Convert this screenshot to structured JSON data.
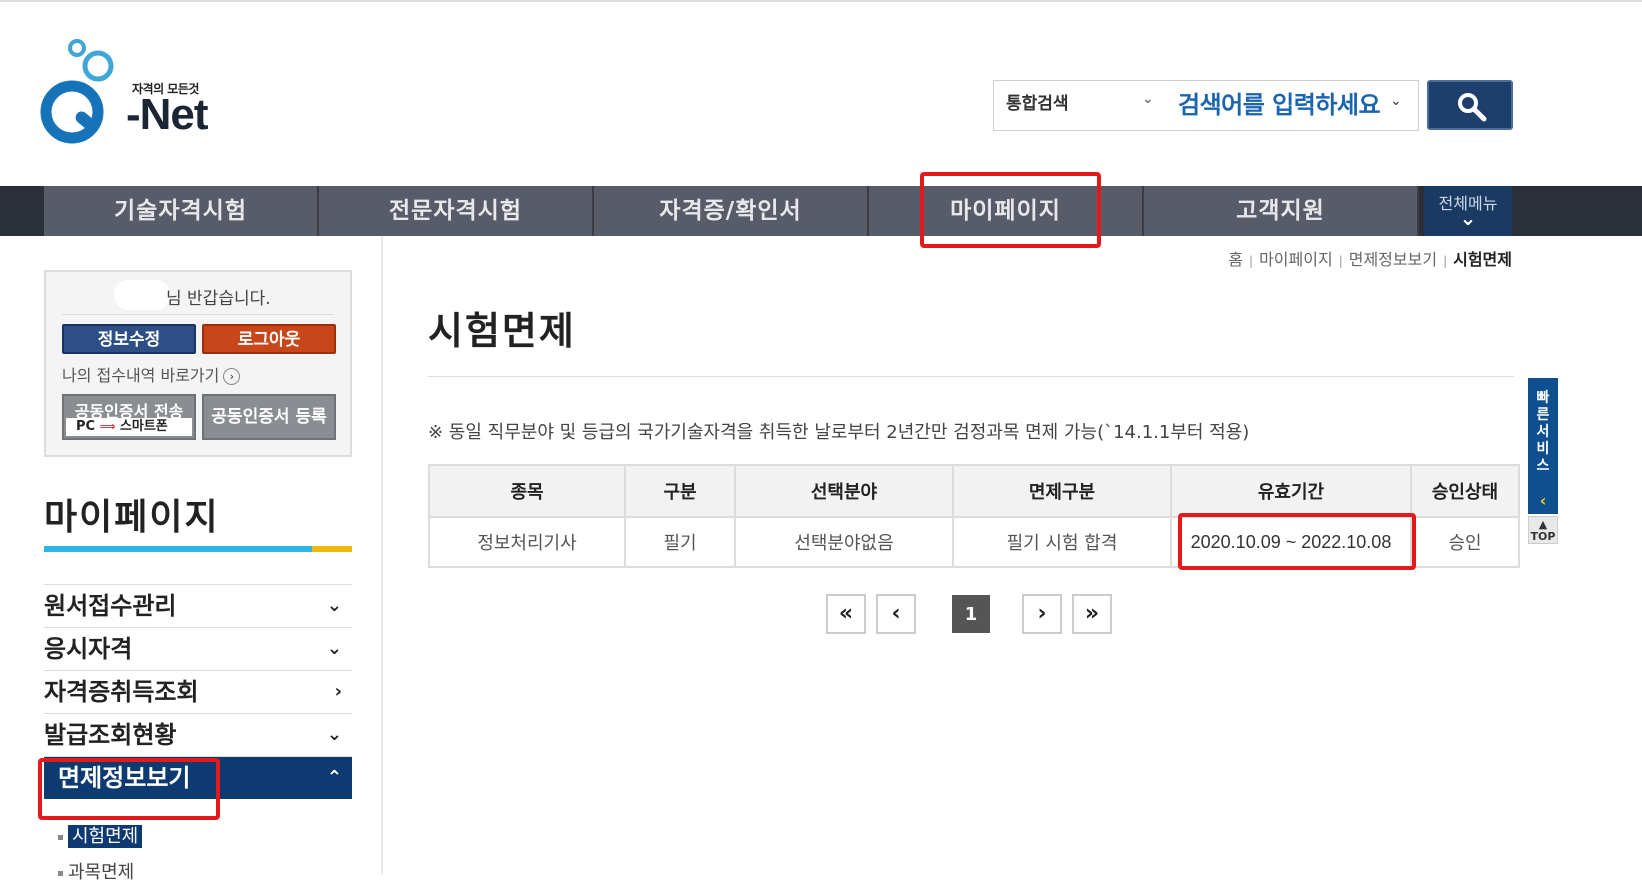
{
  "logo": {
    "tagline": "자격의 모든것",
    "name": "-Net"
  },
  "search": {
    "category": "통합검색",
    "placeholder": "검색어를 입력하세요"
  },
  "nav": {
    "items": [
      "기술자격시험",
      "전문자격시험",
      "자격증/확인서",
      "마이페이지",
      "고객지원"
    ],
    "all_menu": "전체메뉴"
  },
  "user": {
    "greeting": "님 반갑습니다.",
    "edit_button": "정보수정",
    "logout_button": "로그아웃",
    "receipt_link": "나의 접수내역 바로가기",
    "cert_transfer": "공동인증서 전송",
    "cert_transfer_sub_from": "PC",
    "cert_transfer_sub_to": "스마트폰",
    "cert_register": "공동인증서 등록"
  },
  "sidebar": {
    "title": "마이페이지",
    "menu": [
      {
        "label": "원서접수관리",
        "chevron": "⌄"
      },
      {
        "label": "응시자격",
        "chevron": "⌄"
      },
      {
        "label": "자격증취득조회",
        "chevron": "›"
      },
      {
        "label": "발급조회현황",
        "chevron": "⌄"
      },
      {
        "label": "면제정보보기",
        "chevron": "⌃"
      }
    ],
    "submenu": [
      "시험면제",
      "과목면제"
    ]
  },
  "breadcrumb": [
    "홈",
    "마이페이지",
    "면제정보보기",
    "시험면제"
  ],
  "main": {
    "title": "시험면제",
    "notice": "※ 동일 직무분야 및 등급의 국가기술자격을 취득한 날로부터 2년간만 검정과목 면제 가능(`14.1.1부터 적용)",
    "table": {
      "headers": [
        "종목",
        "구분",
        "선택분야",
        "면제구분",
        "유효기간",
        "승인상태"
      ],
      "rows": [
        [
          "정보처리기사",
          "필기",
          "선택분야없음",
          "필기 시험 합격",
          "2020.10.09 ~ 2022.10.08",
          "승인"
        ]
      ]
    },
    "pagination": {
      "first": "«",
      "prev": "‹",
      "current": "1",
      "next": "›",
      "last": "»"
    }
  },
  "quick": {
    "label": "빠른서비스",
    "top": "TOP"
  },
  "colors": {
    "nav_bg": "#585c68",
    "active_menu": "#0d3a70",
    "highlight": "#e41a1a",
    "accent": "#2eb4e6"
  }
}
